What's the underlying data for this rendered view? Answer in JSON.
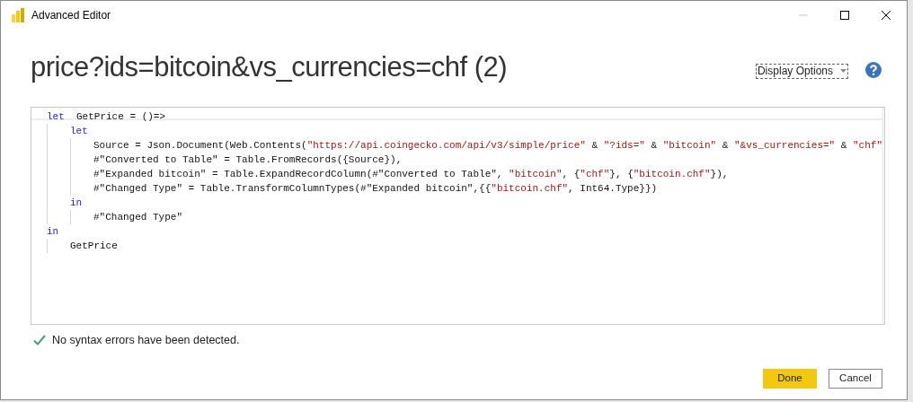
{
  "window": {
    "title": "Advanced Editor"
  },
  "heading": "price?ids=bitcoin&vs_currencies=chf (2)",
  "display_options": "Display Options",
  "code": [
    {
      "tokens": [
        {
          "kind": "keyword",
          "text": "let"
        },
        {
          "kind": "text",
          "text": "  GetPrice = ()=>"
        }
      ],
      "children": [
        {
          "tokens": [
            {
              "kind": "keyword",
              "text": "let"
            }
          ],
          "children": [
            {
              "tokens": [
                {
                  "kind": "text",
                  "text": "Source = Json.Document(Web.Contents("
                },
                {
                  "kind": "string",
                  "text": "\"https://api.coingecko.com/api/v3/simple/price\""
                },
                {
                  "kind": "text",
                  "text": " & "
                },
                {
                  "kind": "string",
                  "text": "\"?ids=\""
                },
                {
                  "kind": "text",
                  "text": " & "
                },
                {
                  "kind": "string",
                  "text": "\"bitcoin\""
                },
                {
                  "kind": "text",
                  "text": " & "
                },
                {
                  "kind": "string",
                  "text": "\"&vs_currencies=\""
                },
                {
                  "kind": "text",
                  "text": " & "
                },
                {
                  "kind": "string",
                  "text": "\"chf\""
                }
              ]
            },
            {
              "tokens": [
                {
                  "kind": "text",
                  "text": "#\"Converted to Table\" = Table.FromRecords({Source}),"
                }
              ]
            },
            {
              "tokens": [
                {
                  "kind": "text",
                  "text": "#\"Expanded bitcoin\" = Table.ExpandRecordColumn(#\"Converted to Table\", "
                },
                {
                  "kind": "string",
                  "text": "\"bitcoin\""
                },
                {
                  "kind": "text",
                  "text": ", {"
                },
                {
                  "kind": "string",
                  "text": "\"chf\""
                },
                {
                  "kind": "text",
                  "text": "}, {"
                },
                {
                  "kind": "string",
                  "text": "\"bitcoin.chf\""
                },
                {
                  "kind": "text",
                  "text": "}),"
                }
              ]
            },
            {
              "tokens": [
                {
                  "kind": "text",
                  "text": "#\"Changed Type\" = Table.TransformColumnTypes(#\"Expanded bitcoin\",{{"
                },
                {
                  "kind": "string",
                  "text": "\"bitcoin.chf\""
                },
                {
                  "kind": "text",
                  "text": ", Int64.Type}})"
                }
              ]
            }
          ]
        },
        {
          "tokens": [
            {
              "kind": "keyword",
              "text": "in"
            }
          ],
          "children": [
            {
              "tokens": [
                {
                  "kind": "text",
                  "text": "#\"Changed Type\""
                }
              ]
            }
          ]
        }
      ]
    },
    {
      "tokens": [
        {
          "kind": "keyword",
          "text": "in"
        }
      ],
      "children": [
        {
          "tokens": [
            {
              "kind": "text",
              "text": "GetPrice"
            }
          ]
        }
      ]
    }
  ],
  "status": "No syntax errors have been detected.",
  "buttons": [
    {
      "kind": "primary",
      "label": "Done"
    },
    {
      "kind": "secondary",
      "label": "Cancel"
    }
  ]
}
